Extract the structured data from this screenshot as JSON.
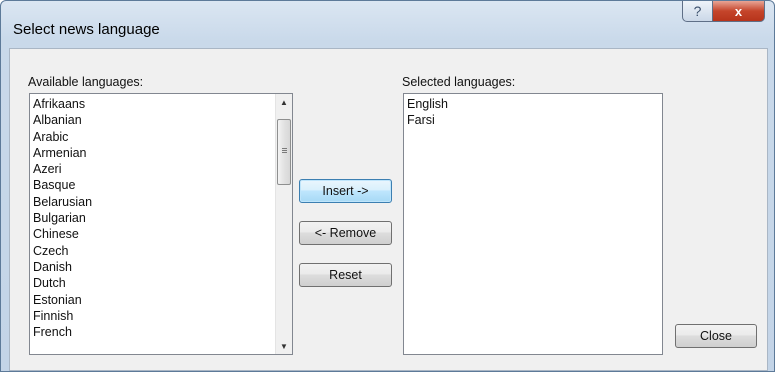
{
  "window": {
    "title": "Select news language",
    "help_glyph": "?",
    "close_glyph": "x"
  },
  "available": {
    "label": "Available languages:",
    "items": [
      "Afrikaans",
      "Albanian",
      "Arabic",
      "Armenian",
      "Azeri",
      "Basque",
      "Belarusian",
      "Bulgarian",
      "Chinese",
      "Czech",
      "Danish",
      "Dutch",
      "Estonian",
      "Finnish",
      "French"
    ]
  },
  "selected": {
    "label": "Selected languages:",
    "items": [
      "English",
      "Farsi"
    ]
  },
  "buttons": {
    "insert": "Insert ->",
    "remove": "<- Remove",
    "reset": "Reset",
    "close": "Close"
  },
  "icons": {
    "scroll_up": "scroll-up-arrow-icon",
    "scroll_down": "scroll-down-arrow-icon",
    "help": "help-icon",
    "close": "close-icon"
  }
}
